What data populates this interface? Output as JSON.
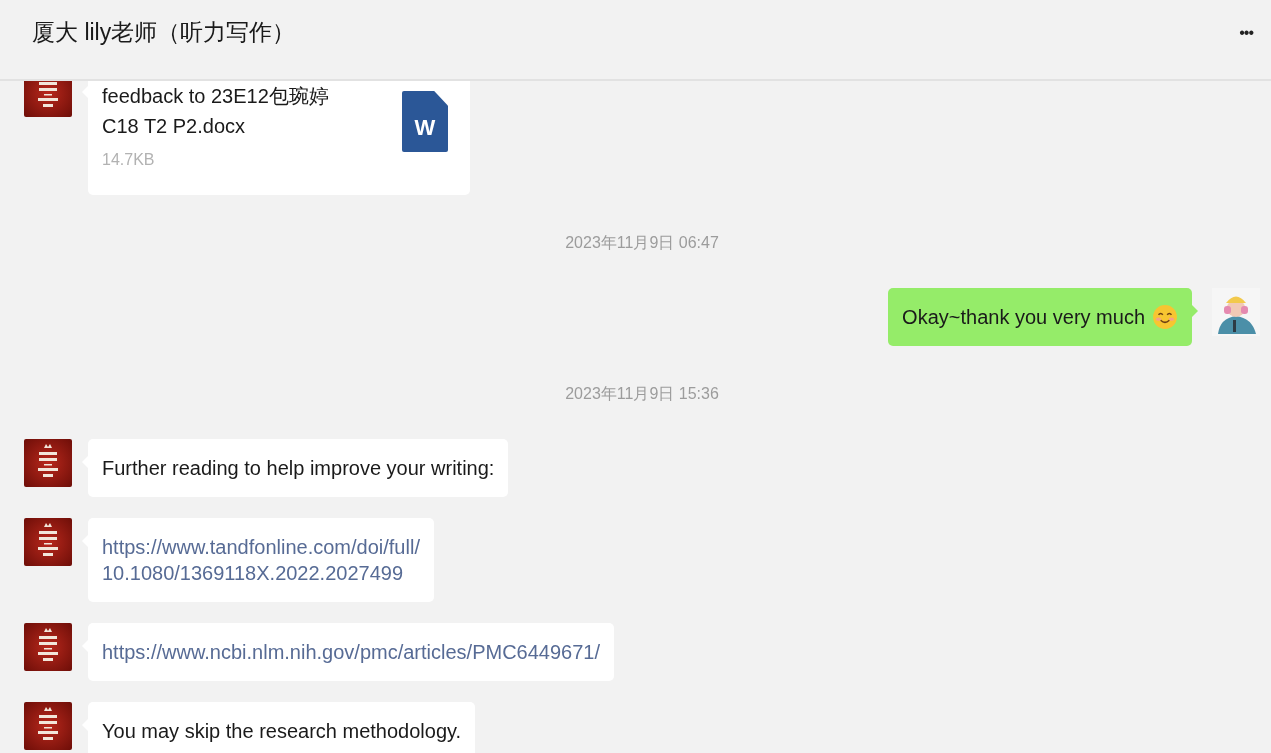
{
  "header": {
    "title": "厦大 lily老师（听力写作）",
    "more": "•••"
  },
  "messages": [
    {
      "kind": "file",
      "outgoing": false,
      "name_lines": [
        "feedback to 23E12包琬婷",
        "C18 T2 P2.docx"
      ],
      "size": "14.7KB",
      "file_type": "W"
    },
    {
      "kind": "time",
      "text": "2023年11月9日 06:47"
    },
    {
      "kind": "text",
      "outgoing": true,
      "text": "Okay~thank you very much",
      "emoji": true
    },
    {
      "kind": "time",
      "text": "2023年11月9日 15:36"
    },
    {
      "kind": "text",
      "outgoing": false,
      "text": "Further reading to help improve your writing:"
    },
    {
      "kind": "link",
      "outgoing": false,
      "lines": [
        "https://www.tandfonline.com/doi/full/",
        "10.1080/1369118X.2022.2027499"
      ]
    },
    {
      "kind": "link",
      "outgoing": false,
      "lines": [
        "https://www.ncbi.nlm.nih.gov/pmc/articles/PMC6449671/"
      ]
    },
    {
      "kind": "text",
      "outgoing": false,
      "text": "You may skip the research methodology."
    }
  ]
}
